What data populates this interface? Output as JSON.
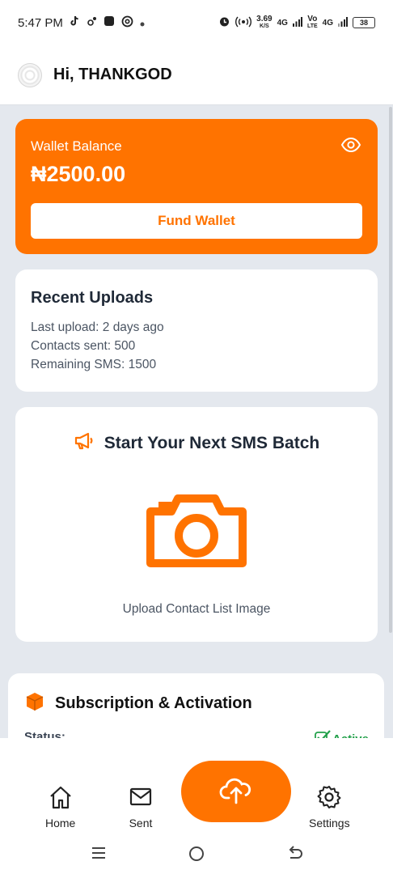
{
  "status_bar": {
    "time": "5:47 PM",
    "network_speed": "3.69",
    "network_speed_unit": "K/S",
    "sim1": "4G",
    "volte": "Vo",
    "volte_sub": "LTE",
    "sim2": "4G",
    "battery": "38"
  },
  "header": {
    "greeting": "Hi, THANKGOD"
  },
  "wallet": {
    "label": "Wallet Balance",
    "amount": "₦2500.00",
    "fund_button": "Fund Wallet"
  },
  "recent_uploads": {
    "title": "Recent Uploads",
    "last_upload": "Last upload: 2 days ago",
    "contacts_sent": "Contacts sent: 500",
    "remaining_sms": "Remaining SMS: 1500"
  },
  "batch": {
    "title": "Start Your Next SMS Batch",
    "upload_label": "Upload Contact List Image"
  },
  "subscription": {
    "title": "Subscription & Activation",
    "status_label": "Status:",
    "status_value": "Active"
  },
  "bottom_nav": {
    "home": "Home",
    "sent": "Sent",
    "settings": "Settings"
  },
  "colors": {
    "accent": "#ff7300",
    "active": "#22a04a",
    "background": "#e4e8ee"
  },
  "icons": [
    "tiktok-icon",
    "notification-icon",
    "app-icon",
    "threads-icon",
    "alarm-icon",
    "hotspot-icon",
    "signal-icon",
    "battery-icon",
    "avatar",
    "eye-icon",
    "megaphone-icon",
    "camera-icon",
    "box-icon",
    "check-icon",
    "home-icon",
    "mail-icon",
    "cloud-upload-icon",
    "gear-icon",
    "menu-icon",
    "home-circle-icon",
    "back-icon"
  ]
}
